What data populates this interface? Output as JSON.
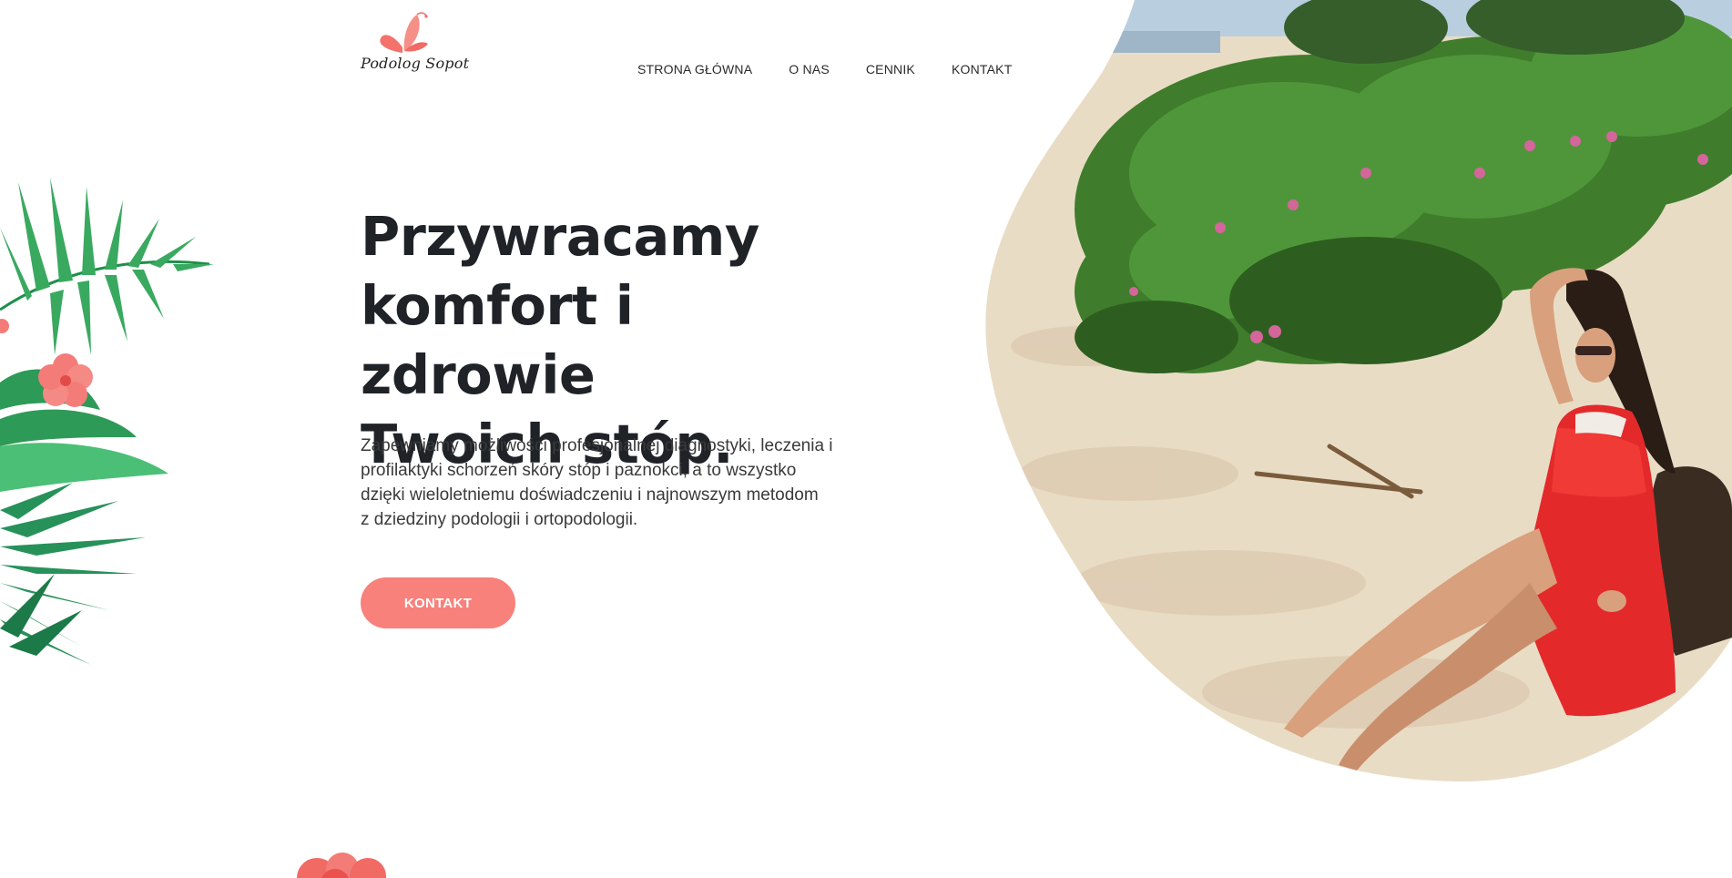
{
  "brand": {
    "logo_text": "Podolog Sopot",
    "logo_icon": "butterfly-icon",
    "accent_color": "#f8817b"
  },
  "nav": {
    "items": [
      {
        "label": "STRONA GŁÓWNA"
      },
      {
        "label": "O NAS"
      },
      {
        "label": "CENNIK"
      },
      {
        "label": "KONTAKT"
      }
    ]
  },
  "hero": {
    "title_line_1": "Przywracamy",
    "title_line_2": "komfort i zdrowie",
    "title_line_3": "Twoich stóp.",
    "desc_line_1": "Zapewniamy możliwości profesjonalnej diagnostyki, leczenia i",
    "desc_line_2": "profilaktyki schorzeń skóry stóp i paznokci, a to wszystko",
    "desc_line_3": "dzięki wieloletniemu doświadczeniu i najnowszym metodom",
    "desc_line_4": "z dziedziny podologii i ortopodologii.",
    "cta_label": "KONTAKT"
  }
}
